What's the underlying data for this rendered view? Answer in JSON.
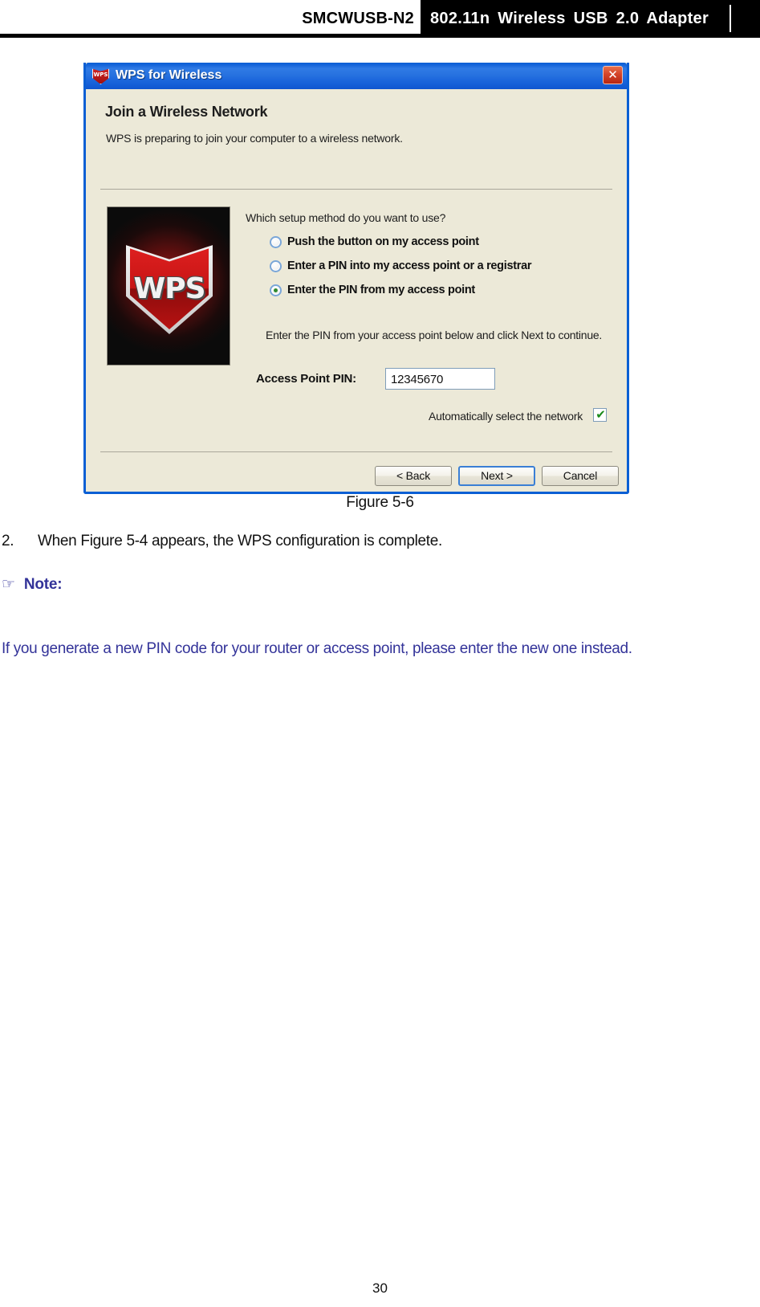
{
  "header": {
    "model": "SMCWUSB-N2",
    "product": "802.11n  Wireless  USB  2.0  Adapter"
  },
  "dialog": {
    "titlebar": {
      "icon_label": "WPS",
      "title": "WPS for Wireless",
      "close_glyph": "✕"
    },
    "heading": "Join a Wireless Network",
    "subheading": "WPS is preparing to join your computer to a wireless network.",
    "hero_logo_text": "WPS",
    "question": "Which setup method do you want to use?",
    "options": [
      {
        "label": "Push the button on my access point",
        "selected": false
      },
      {
        "label": "Enter a PIN into my access point or a registrar",
        "selected": false
      },
      {
        "label": "Enter the PIN from my access point",
        "selected": true
      }
    ],
    "hint": "Enter the PIN from your access point below and click Next to continue.",
    "pin_label": "Access Point PIN:",
    "pin_value": "12345670",
    "auto_select_label": "Automatically select the network",
    "auto_select_checked": true,
    "auto_select_glyph": "✔",
    "buttons": {
      "back": "< Back",
      "next": "Next >",
      "cancel": "Cancel"
    }
  },
  "figure_caption": "Figure 5-6",
  "step": {
    "number": "2.",
    "text": "When Figure 5-4 appears, the WPS configuration is complete."
  },
  "note": {
    "hand_glyph": "☞",
    "title": "Note:",
    "body": "If you generate a new PIN code for your router or access point, please enter the new one instead."
  },
  "page_number": "30",
  "colors": {
    "titlebar_blue": "#1464da",
    "dialog_face": "#ece9d8",
    "note_blue": "#333399",
    "accent_red": "#c71515"
  }
}
